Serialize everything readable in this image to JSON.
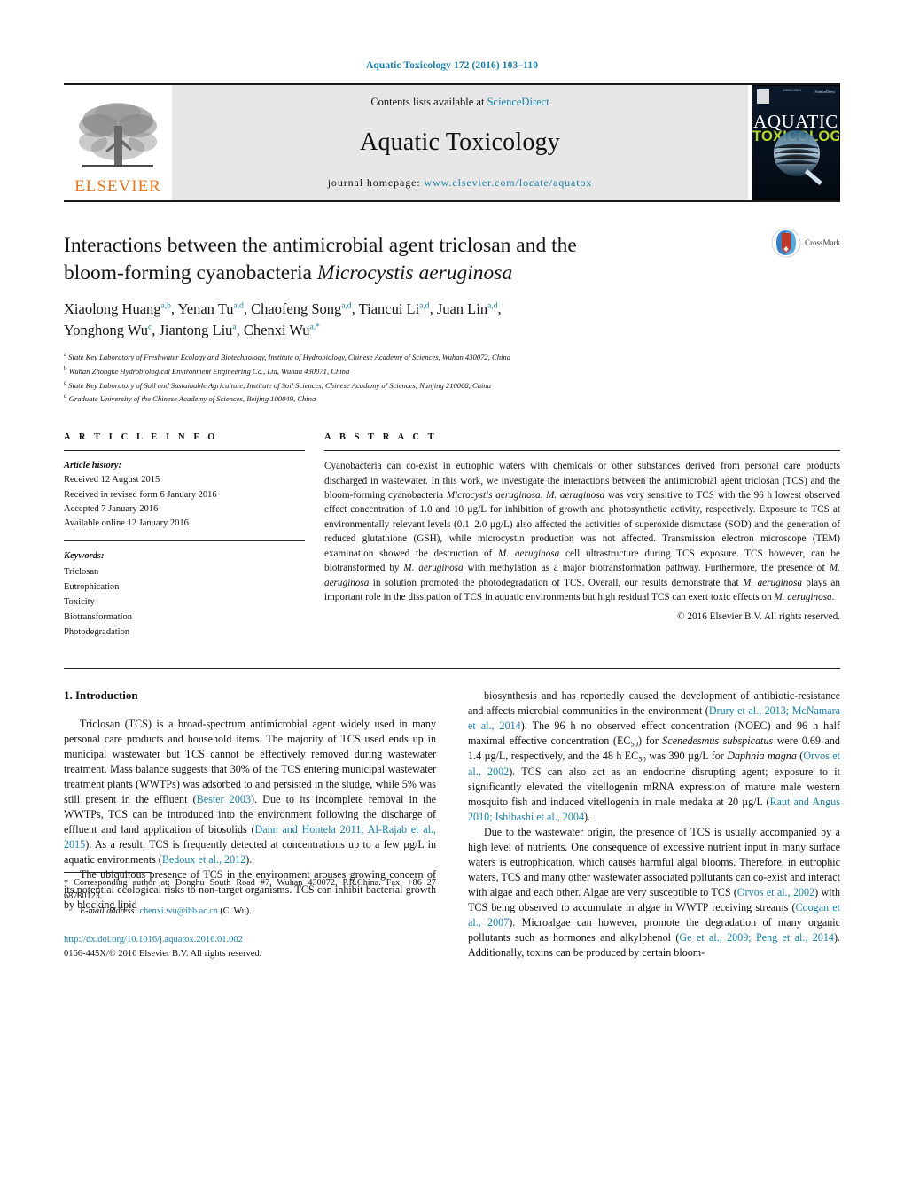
{
  "running_head": "Aquatic Toxicology 172 (2016) 103–110",
  "masthead": {
    "publisher_name": "ELSEVIER",
    "contents_prefix": "Contents lists available at ",
    "contents_link": "ScienceDirect",
    "journal_title": "Aquatic Toxicology",
    "homepage_prefix": "journal homepage: ",
    "homepage_url": "www.elsevier.com/locate/aquatox",
    "cover": {
      "line_top_left": "Available online at",
      "line_top_right": "ScienceDirect",
      "title_1": "AQUATIC",
      "title_2": "TOXICOLOGY"
    }
  },
  "title": {
    "line1": "Interactions between the antimicrobial agent triclosan and the",
    "line2_plain": "bloom-forming cyanobacteria ",
    "line2_italic": "Microcystis aeruginosa",
    "crossmark_label": "CrossMark"
  },
  "authors": [
    {
      "name": "Xiaolong Huang",
      "sup": "a,b",
      "sep": ", "
    },
    {
      "name": "Yenan Tu",
      "sup": "a,d",
      "sep": ", "
    },
    {
      "name": "Chaofeng Song",
      "sup": "a,d",
      "sep": ", "
    },
    {
      "name": "Tiancui Li",
      "sup": "a,d",
      "sep": ", "
    },
    {
      "name": "Juan Lin",
      "sup": "a,d",
      "sep": ", "
    },
    {
      "name": "Yonghong Wu",
      "sup": "c",
      "sep": ", "
    },
    {
      "name": "Jiantong Liu",
      "sup": "a",
      "sep": ", "
    },
    {
      "name": "Chenxi Wu",
      "sup": "a,*",
      "sep": ""
    }
  ],
  "affiliations": [
    {
      "key": "a",
      "text": "State Key Laboratory of Freshwater Ecology and Biotechnology, Institute of Hydrobiology, Chinese Academy of Sciences, Wuhan 430072, China"
    },
    {
      "key": "b",
      "text": "Wuhan Zhongke Hydrobiological Environment Engineering Co., Ltd, Wuhan 430071, China"
    },
    {
      "key": "c",
      "text": "State Key Laboratory of Soil and Sustainable Agriculture, Institute of Soil Sciences, Chinese Academy of Sciences, Nanjing 210008, China"
    },
    {
      "key": "d",
      "text": "Graduate University of the Chinese Academy of Sciences, Beijing 100049, China"
    }
  ],
  "article_info": {
    "heading": "A R T I C L E    I N F O",
    "history_label": "Article history:",
    "history": [
      "Received 12 August 2015",
      "Received in revised form 6 January 2016",
      "Accepted 7 January 2016",
      "Available online 12 January 2016"
    ],
    "keywords_label": "Keywords:",
    "keywords": [
      "Triclosan",
      "Eutrophication",
      "Toxicity",
      "Biotransformation",
      "Photodegradation"
    ]
  },
  "abstract": {
    "heading": "A B S T R A C T",
    "parts": [
      {
        "t": "Cyanobacteria can co-exist in eutrophic waters with chemicals or other substances derived from personal care products discharged in wastewater. In this work, we investigate the interactions between the antimicrobial agent triclosan (TCS) and the bloom-forming cyanobacteria ",
        "i": false
      },
      {
        "t": "Microcystis aeruginosa",
        "i": true
      },
      {
        "t": ". ",
        "i": false
      },
      {
        "t": "M. aeruginosa",
        "i": true
      },
      {
        "t": " was very sensitive to TCS with the 96 h lowest observed effect concentration of 1.0 and 10 µg/L for inhibition of growth and photosynthetic activity, respectively. Exposure to TCS at environmentally relevant levels (0.1–2.0 µg/L) also affected the activities of superoxide dismutase (SOD) and the generation of reduced glutathione (GSH), while microcystin production was not affected. Transmission electron microscope (TEM) examination showed the destruction of ",
        "i": false
      },
      {
        "t": "M. aeruginosa",
        "i": true
      },
      {
        "t": " cell ultrastructure during TCS exposure. TCS however, can be biotransformed by ",
        "i": false
      },
      {
        "t": "M. aeruginosa",
        "i": true
      },
      {
        "t": " with methylation as a major biotransformation pathway. Furthermore, the presence of ",
        "i": false
      },
      {
        "t": "M. aeruginosa",
        "i": true
      },
      {
        "t": " in solution promoted the photodegradation of TCS. Overall, our results demonstrate that ",
        "i": false
      },
      {
        "t": "M. aeruginosa",
        "i": true
      },
      {
        "t": " plays an important role in the dissipation of TCS in aquatic environments but high residual TCS can exert toxic effects on ",
        "i": false
      },
      {
        "t": "M. aeruginosa",
        "i": true
      },
      {
        "t": ".",
        "i": false
      }
    ],
    "copyright": "© 2016 Elsevier B.V. All rights reserved."
  },
  "introduction": {
    "heading": "1.  Introduction",
    "left_paragraphs": [
      [
        {
          "t": "Triclosan (TCS) is a broad-spectrum antimicrobial agent widely used in many personal care products and household items. The majority of TCS used ends up in municipal wastewater but TCS cannot be effectively removed during wastewater treatment. Mass balance suggests that 30% of the TCS entering municipal wastewater treatment plants (WWTPs) was adsorbed to and persisted in the sludge, while 5% was still present in the effluent (",
          "k": "plain"
        },
        {
          "t": "Bester 2003",
          "k": "ref"
        },
        {
          "t": "). Due to its incomplete removal in the WWTPs, TCS can be introduced into the environment following the discharge of effluent and land application of biosolids (",
          "k": "plain"
        },
        {
          "t": "Dann and Hontela 2011; Al-Rajab et al., 2015",
          "k": "ref"
        },
        {
          "t": "). As a result, TCS is frequently detected at concentrations up to a few µg/L in aquatic environments (",
          "k": "plain"
        },
        {
          "t": "Bedoux et al., 2012",
          "k": "ref"
        },
        {
          "t": ").",
          "k": "plain"
        }
      ],
      [
        {
          "t": "The ubiquitous presence of TCS in the environment arouses growing concern of its potential ecological risks to non-target organisms. TCS can inhibit bacterial growth by blocking lipid",
          "k": "plain"
        }
      ]
    ],
    "right_paragraphs": [
      [
        {
          "t": "biosynthesis and has reportedly caused the development of antibiotic-resistance and affects microbial communities in the environment (",
          "k": "plain"
        },
        {
          "t": "Drury et al., 2013; McNamara et al., 2014",
          "k": "ref"
        },
        {
          "t": "). The 96 h no observed effect concentration (NOEC) and 96 h half maximal effective concentration (EC",
          "k": "plain"
        },
        {
          "t": "50",
          "k": "sub"
        },
        {
          "t": ") for ",
          "k": "plain"
        },
        {
          "t": "Scenedesmus subspicatus",
          "k": "ital"
        },
        {
          "t": " were 0.69 and 1.4 µg/L, respectively, and the 48 h EC",
          "k": "plain"
        },
        {
          "t": "50",
          "k": "sub"
        },
        {
          "t": " was 390 µg/L for ",
          "k": "plain"
        },
        {
          "t": "Daphnia magna",
          "k": "ital"
        },
        {
          "t": " (",
          "k": "plain"
        },
        {
          "t": "Orvos et al., 2002",
          "k": "ref"
        },
        {
          "t": "). TCS can also act as an endocrine disrupting agent; exposure to it significantly elevated the vitellogenin mRNA expression of mature male western mosquito fish and induced vitellogenin in male medaka at 20 µg/L (",
          "k": "plain"
        },
        {
          "t": "Raut and Angus 2010; Ishibashi et al., 2004",
          "k": "ref"
        },
        {
          "t": ").",
          "k": "plain"
        }
      ],
      [
        {
          "t": "Due to the wastewater origin, the presence of TCS is usually accompanied by a high level of nutrients. One consequence of excessive nutrient input in many surface waters is eutrophication, which causes harmful algal blooms. Therefore, in eutrophic waters, TCS and many other wastewater associated pollutants can co-exist and interact with algae and each other. Algae are very susceptible to TCS (",
          "k": "plain"
        },
        {
          "t": "Orvos et al., 2002",
          "k": "ref"
        },
        {
          "t": ") with TCS being observed to accumulate in algae in WWTP receiving streams (",
          "k": "plain"
        },
        {
          "t": "Coogan et al., 2007",
          "k": "ref"
        },
        {
          "t": "). Microalgae can however, promote the degradation of many organic pollutants such as hormones and alkylphenol (",
          "k": "plain"
        },
        {
          "t": "Ge et al., 2009; Peng et al., 2014",
          "k": "ref"
        },
        {
          "t": "). Additionally, toxins can be produced by certain bloom-",
          "k": "plain"
        }
      ]
    ]
  },
  "footnote": {
    "corresponding": "*  Corresponding author at: Donghu South Road #7, Wuhan 430072, P.R.China. Fax: +86 27 68780123.",
    "email_label": "E-mail address:",
    "email": "chenxi.wu@ihb.ac.cn",
    "email_suffix": " (C. Wu).",
    "doi": "http://dx.doi.org/10.1016/j.aquatox.2016.01.002",
    "issn": "0166-445X/© 2016 Elsevier B.V. All rights reserved."
  },
  "colors": {
    "link": "#1a7fa8",
    "elsevier_orange": "#E87722",
    "cover_green": "#b9d72a"
  }
}
